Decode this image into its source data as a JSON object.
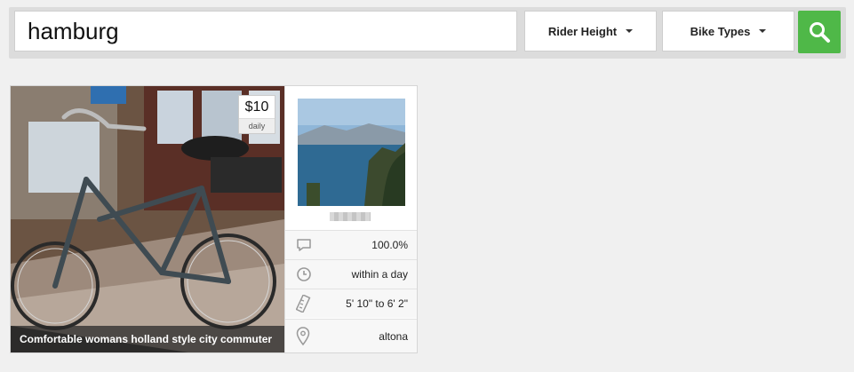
{
  "search": {
    "query": "hamburg"
  },
  "filters": {
    "rider_height_label": "Rider Height",
    "bike_types_label": "Bike Types"
  },
  "listing": {
    "price": "$10",
    "price_period": "daily",
    "title": "Comfortable womans holland style city commuter",
    "stats": {
      "response_rate": "100.0%",
      "response_time": "within a day",
      "rider_height": "5' 10\" to 6' 2\"",
      "location": "altona"
    }
  },
  "colors": {
    "accent": "#4fb848",
    "background": "#f0f0f0"
  },
  "icons": [
    "search-icon",
    "chat-bubble-icon",
    "clock-icon",
    "ruler-icon",
    "map-pin-icon"
  ]
}
